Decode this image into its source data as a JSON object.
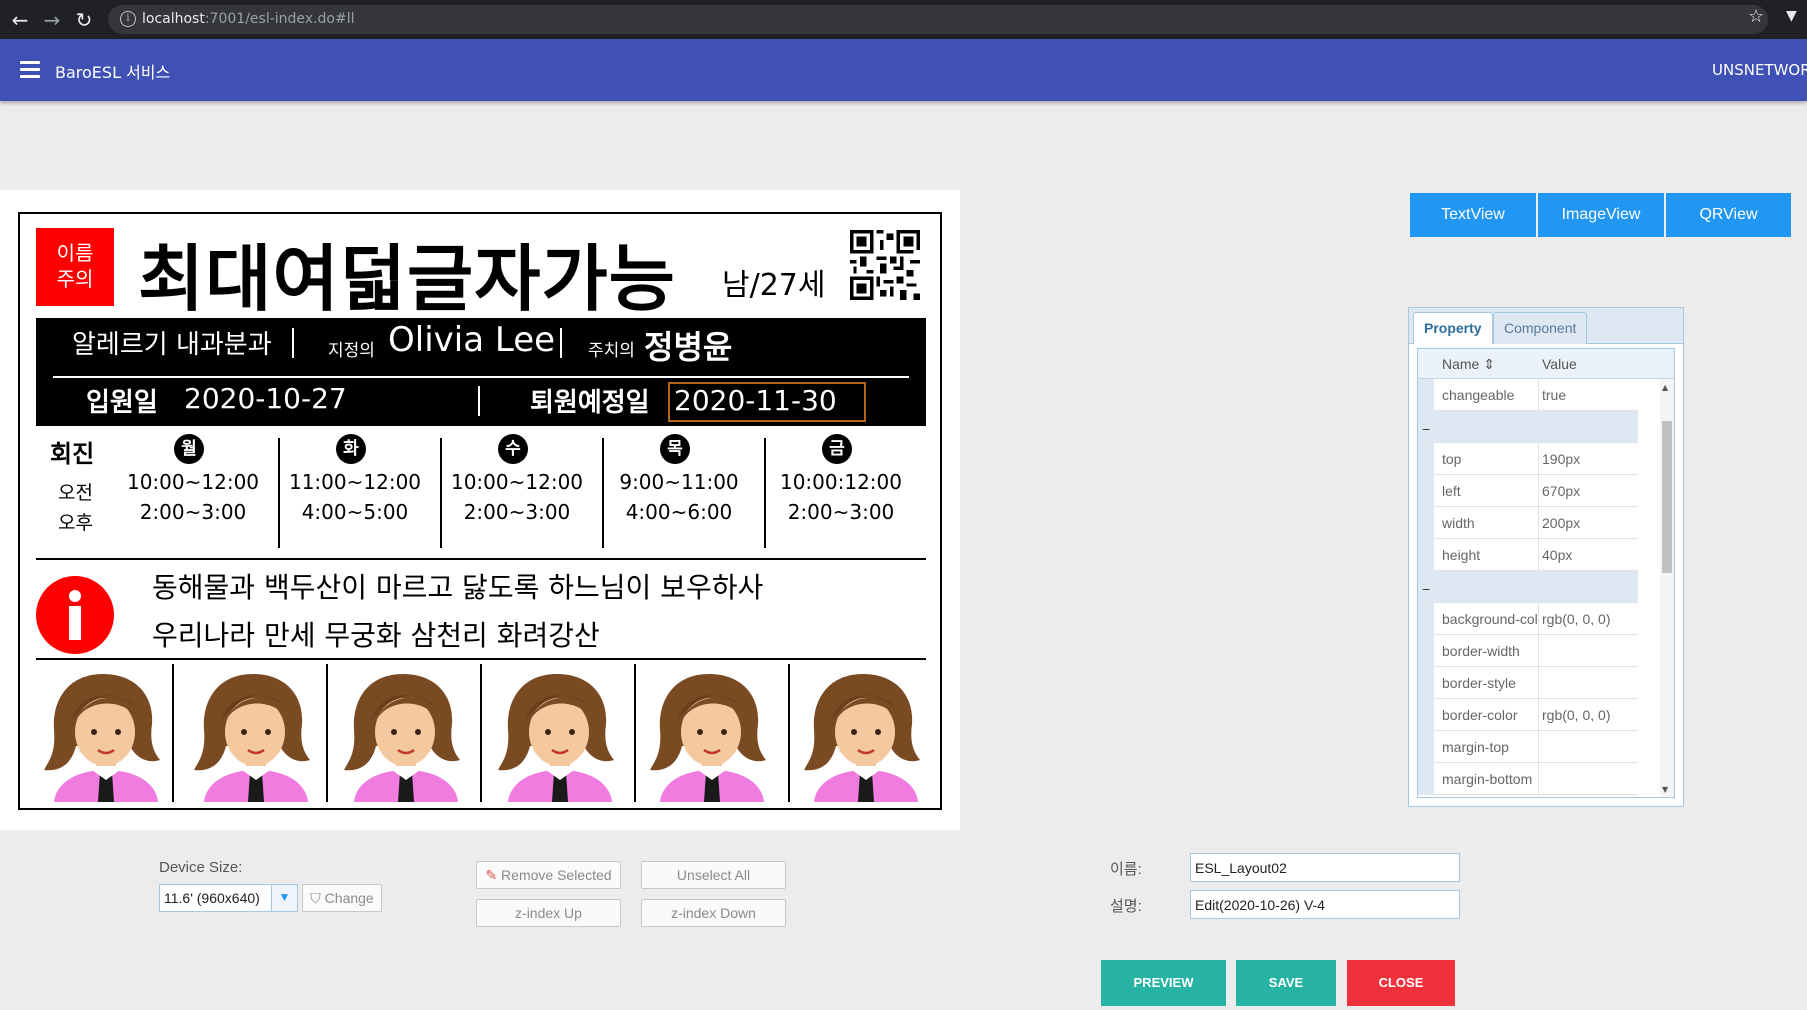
{
  "browser": {
    "url_host": "localhost",
    "url_path": ":7001/esl-index.do#ll"
  },
  "appbar": {
    "title": "BaroESL 서비스",
    "user": "UNSNETWORK"
  },
  "label": {
    "warning_line1": "이름",
    "warning_line2": "주의",
    "patient_name": "최대여덟글자가능",
    "gender_age": "남/27세",
    "department": "알레르기 내과분과",
    "assigned_label": "지정의",
    "assigned_doctor": "Olivia Lee",
    "attending_label": "주치의",
    "attending_doctor": "정병윤",
    "admission_label": "입원일",
    "admission_date": "2020-10-27",
    "discharge_label": "퇴원예정일",
    "discharge_date": "2020-11-30",
    "schedule_title": "회진",
    "am_label": "오전",
    "pm_label": "오후",
    "days": [
      {
        "day": "월",
        "am": "10:00~12:00",
        "pm": "2:00~3:00"
      },
      {
        "day": "화",
        "am": "11:00~12:00",
        "pm": "4:00~5:00"
      },
      {
        "day": "수",
        "am": "10:00~12:00",
        "pm": "2:00~3:00"
      },
      {
        "day": "목",
        "am": "9:00~11:00",
        "pm": "4:00~6:00"
      },
      {
        "day": "금",
        "am": "10:00:12:00",
        "pm": "2:00~3:00"
      }
    ],
    "notice_line1": "동해물과 백두산이 마르고 닳도록 하느님이 보우하사",
    "notice_line2": "우리나라 만세 무궁화 삼천리 화려강산",
    "colors": {
      "warning": "#ff0000",
      "band": "#000000",
      "highlight_border": "#b5651d"
    }
  },
  "components": {
    "textview": "TextView",
    "imageview": "ImageView",
    "qrview": "QRView"
  },
  "property_panel": {
    "tab_property": "Property",
    "tab_component": "Component",
    "col_name": "Name ⇕",
    "col_value": "Value",
    "rows": [
      {
        "name": "changeable",
        "value": "true"
      },
      {
        "name": "top",
        "value": "190px"
      },
      {
        "name": "left",
        "value": "670px"
      },
      {
        "name": "width",
        "value": "200px"
      },
      {
        "name": "height",
        "value": "40px"
      },
      {
        "name": "background-col",
        "value": "rgb(0, 0, 0)"
      },
      {
        "name": "border-width",
        "value": ""
      },
      {
        "name": "border-style",
        "value": ""
      },
      {
        "name": "border-color",
        "value": "rgb(0, 0, 0)"
      },
      {
        "name": "margin-top",
        "value": ""
      },
      {
        "name": "margin-bottom",
        "value": ""
      }
    ]
  },
  "controls": {
    "device_size_label": "Device Size:",
    "device_size_value": "11.6' (960x640)",
    "change_label": "Change",
    "remove_selected": "Remove Selected",
    "unselect_all": "Unselect All",
    "z_up": "z-index Up",
    "z_down": "z-index Down",
    "name_label": "이름:",
    "name_value": "ESL_Layout02",
    "desc_label": "설명:",
    "desc_value": "Edit(2020-10-26) V-4",
    "preview": "PREVIEW",
    "save": "SAVE",
    "close": "CLOSE",
    "colors": {
      "preview": "#26b3a3",
      "save": "#26b3a3",
      "close": "#f0303a",
      "primary": "#3f51b5",
      "component": "#2196f3"
    }
  }
}
